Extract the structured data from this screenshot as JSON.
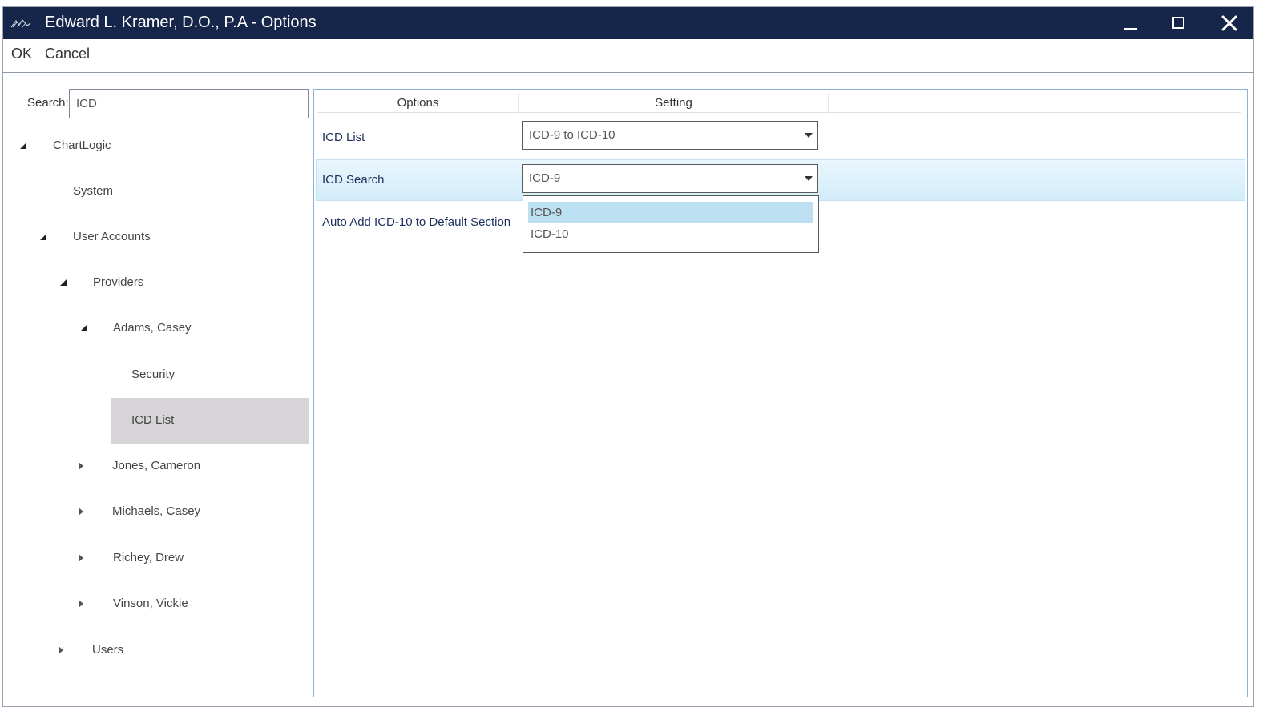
{
  "window": {
    "title": "Edward L. Kramer, D.O., P.A - Options",
    "titlebar_color": "#15264a",
    "icons": {
      "logo": "app-logo-icon",
      "minimize": "minimize-icon",
      "maximize": "maximize-icon",
      "close": "close-icon"
    }
  },
  "menu": {
    "ok_label": "OK",
    "cancel_label": "Cancel"
  },
  "search": {
    "label": "Search:",
    "value": "ICD"
  },
  "tree": {
    "items": [
      {
        "label": "ChartLogic",
        "expander": "expanded"
      },
      {
        "label": "System",
        "expander": "none"
      },
      {
        "label": "User Accounts",
        "expander": "expanded"
      },
      {
        "label": "Providers",
        "expander": "expanded"
      },
      {
        "label": "Adams, Casey",
        "expander": "expanded"
      },
      {
        "label": "Security",
        "expander": "none"
      },
      {
        "label": "ICD List",
        "expander": "none",
        "selected": true
      },
      {
        "label": "Jones, Cameron",
        "expander": "collapsed"
      },
      {
        "label": "Michaels, Casey",
        "expander": "collapsed"
      },
      {
        "label": "Richey, Drew",
        "expander": "collapsed"
      },
      {
        "label": "Vinson, Vickie",
        "expander": "collapsed"
      },
      {
        "label": "Users",
        "expander": "collapsed"
      }
    ]
  },
  "options_grid": {
    "columns": [
      "Options",
      "Setting"
    ],
    "rows": [
      {
        "option": "ICD List",
        "setting": "ICD-9 to ICD-10"
      },
      {
        "option": "ICD Search",
        "setting": "ICD-9",
        "highlighted": true
      },
      {
        "option": "Auto Add ICD-10 to Default Section",
        "setting": ""
      }
    ],
    "dropdown": {
      "open_for": "ICD Search",
      "options": [
        "ICD-9",
        "ICD-10"
      ],
      "selected": "ICD-9"
    }
  },
  "colors": {
    "selection_row": "#d2ecfa",
    "tree_selected": "#d6d4d6",
    "option_text": "#1d2f5c",
    "dropdown_selected": "#bddff2"
  }
}
